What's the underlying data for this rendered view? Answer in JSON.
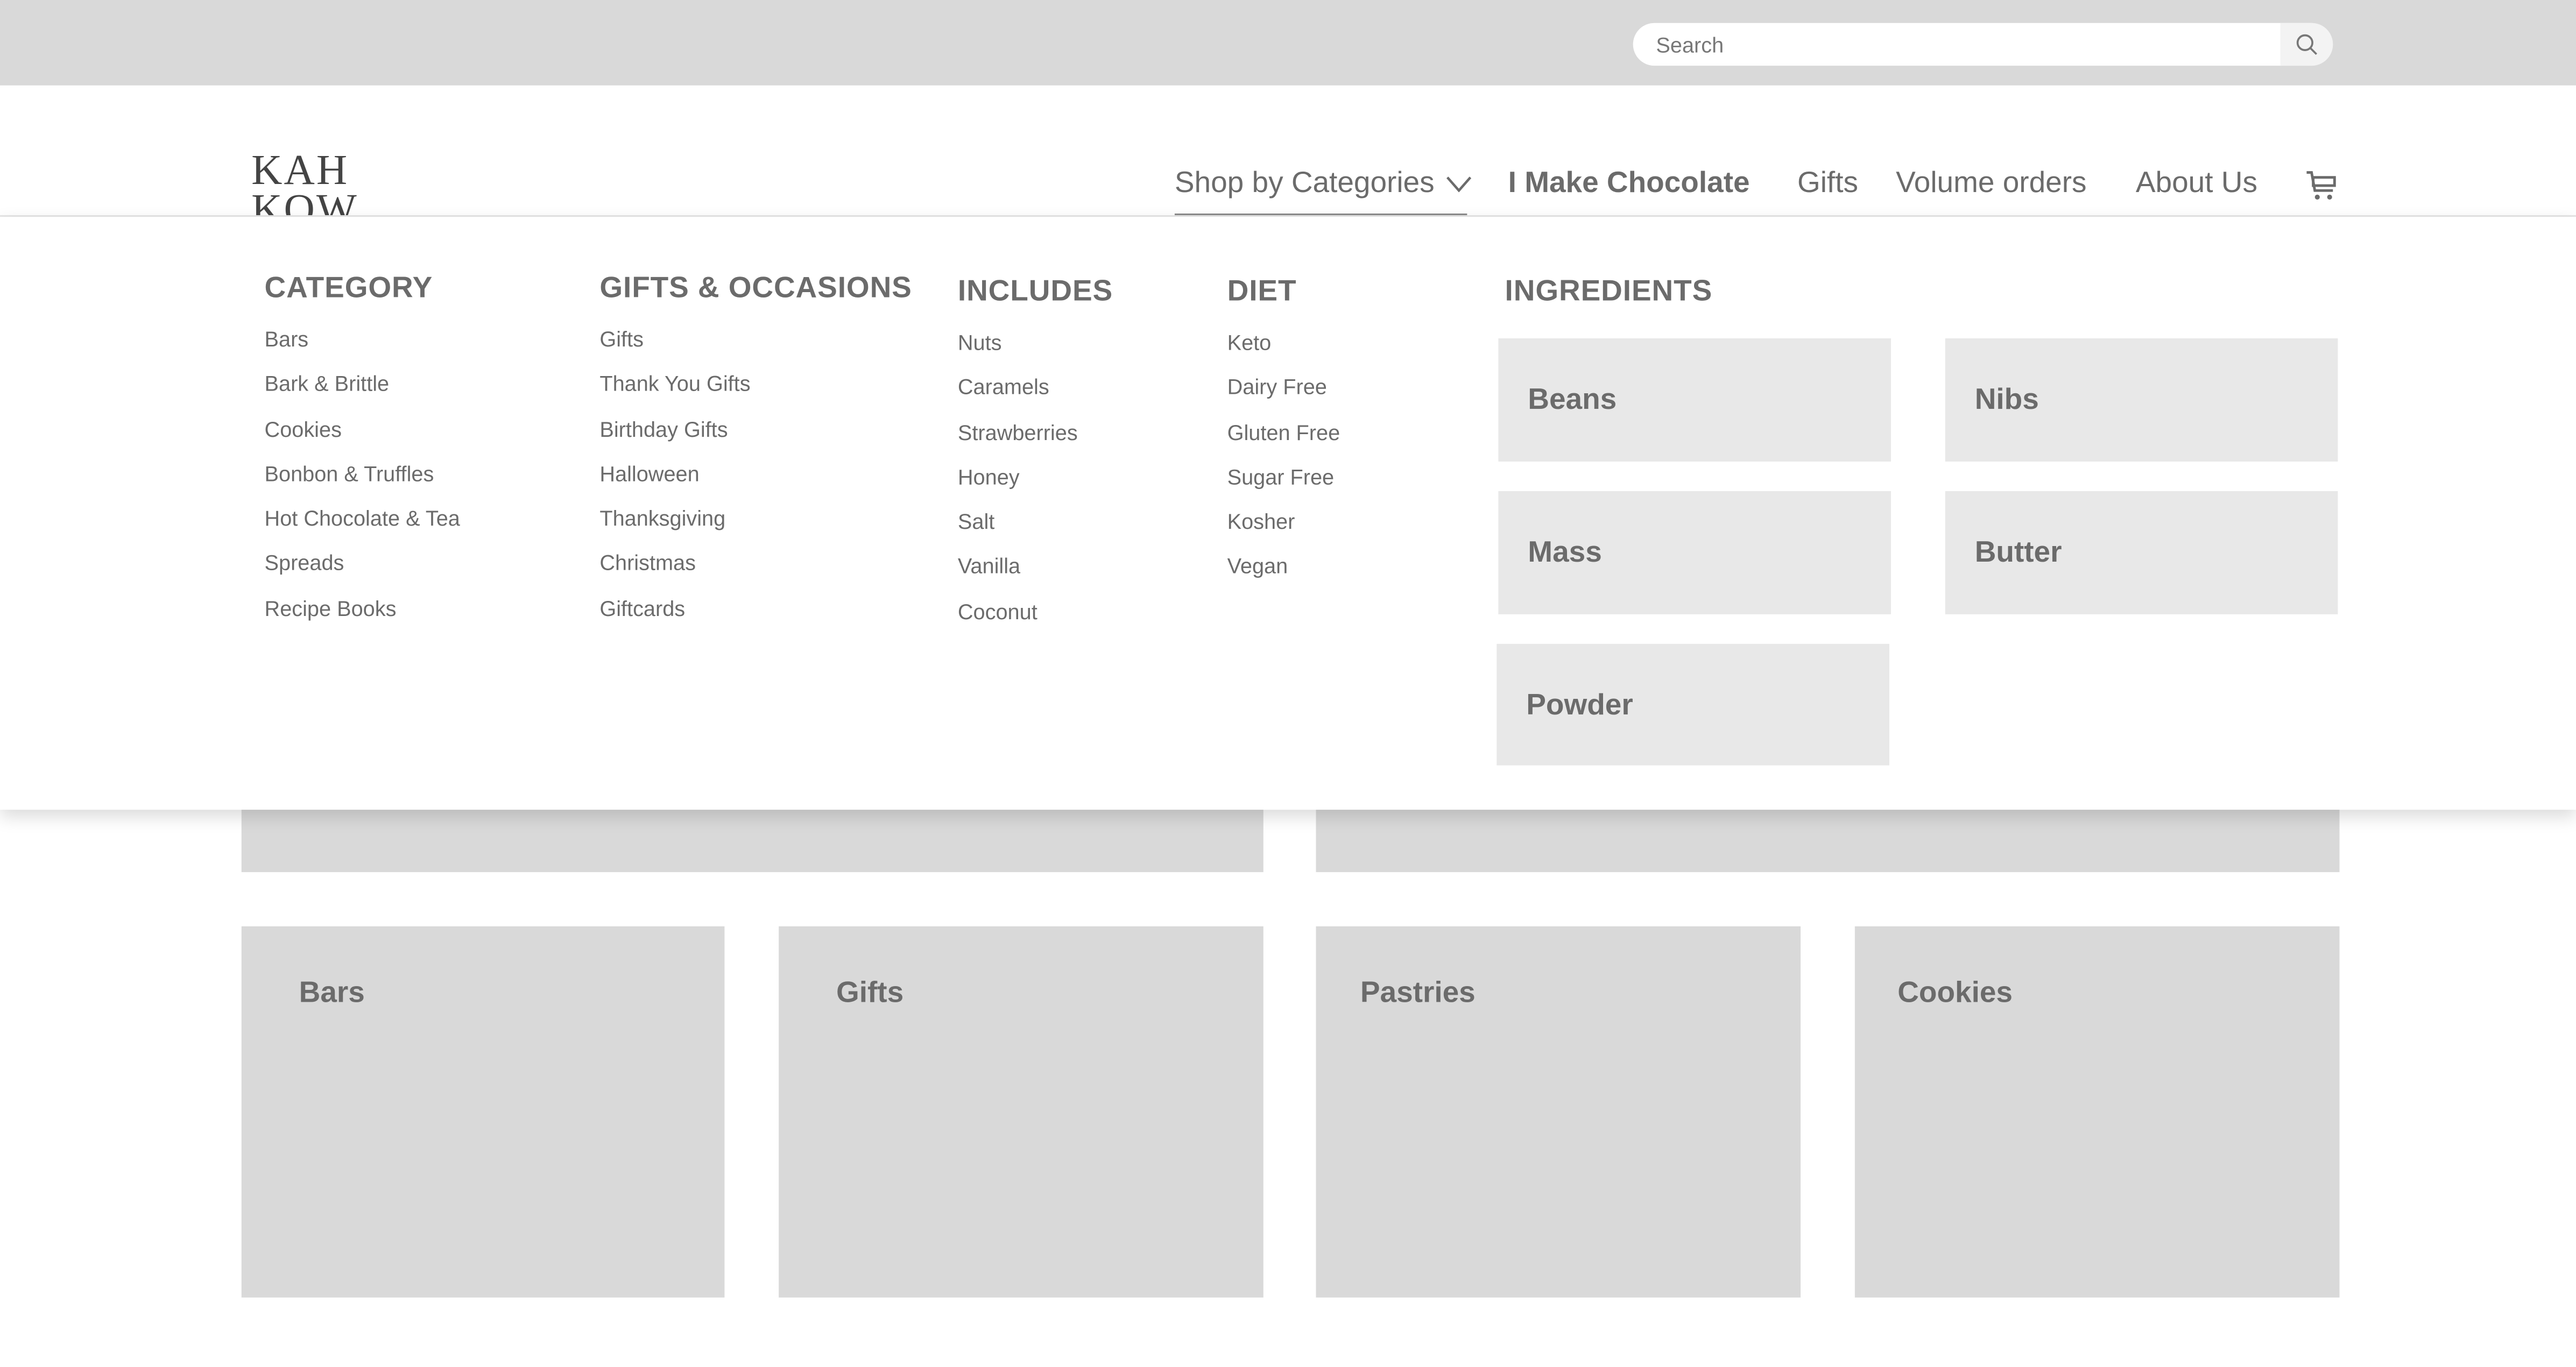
{
  "search": {
    "placeholder": "Search",
    "icon": "search-icon"
  },
  "logo": {
    "line1": "KAH",
    "line2": "KOW"
  },
  "nav": {
    "shop_by_categories": "Shop by Categories",
    "i_make_chocolate": "I Make Chocolate",
    "gifts": "Gifts",
    "volume_orders": "Volume orders",
    "about_us": "About Us",
    "cart_icon": "cart-icon"
  },
  "mega_menu": {
    "category": {
      "heading": "CATEGORY",
      "items": [
        "Bars",
        "Bark & Brittle",
        "Cookies",
        "Bonbon & Truffles",
        "Hot Chocolate & Tea",
        "Spreads",
        "Recipe Books"
      ]
    },
    "gifts_occasions": {
      "heading": "GIFTS & OCCASIONS",
      "items": [
        "Gifts",
        "Thank You Gifts",
        "Birthday Gifts",
        "Halloween",
        "Thanksgiving",
        "Christmas",
        "Giftcards"
      ]
    },
    "includes": {
      "heading": "INCLUDES",
      "items": [
        "Nuts",
        "Caramels",
        "Strawberries",
        "Honey",
        "Salt",
        "Vanilla",
        "Coconut"
      ]
    },
    "diet": {
      "heading": "DIET",
      "items": [
        "Keto",
        "Dairy Free",
        "Gluten Free",
        "Sugar Free",
        "Kosher",
        "Vegan"
      ]
    },
    "ingredients": {
      "heading": "INGREDIENTS",
      "items": [
        "Beans",
        "Nibs",
        "Mass",
        "Butter",
        "Powder"
      ]
    }
  },
  "tiles": [
    "Bars",
    "Gifts",
    "Pastries",
    "Cookies"
  ]
}
